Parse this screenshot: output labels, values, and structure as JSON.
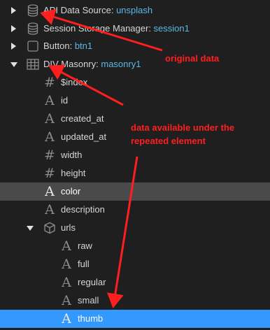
{
  "tree": [
    {
      "name": "API Data Source: ",
      "value": "unsplash",
      "icon": "database-icon",
      "expander": "right"
    },
    {
      "name": "Session Storage Manager: ",
      "value": "session1",
      "icon": "database-icon",
      "expander": "right"
    },
    {
      "name": "Button: ",
      "value": "btn1",
      "icon": "square-icon",
      "expander": "right"
    },
    {
      "name": "DIV Masonry: ",
      "value": "masonry1",
      "icon": "grid-icon",
      "expander": "down"
    },
    {
      "name": "$index",
      "icon": "number-icon"
    },
    {
      "name": "id",
      "icon": "text-icon"
    },
    {
      "name": "created_at",
      "icon": "text-icon"
    },
    {
      "name": "updated_at",
      "icon": "text-icon"
    },
    {
      "name": "width",
      "icon": "number-icon"
    },
    {
      "name": "height",
      "icon": "number-icon"
    },
    {
      "name": "color",
      "icon": "text-icon",
      "selected": "gray"
    },
    {
      "name": "description",
      "icon": "text-icon"
    },
    {
      "name": "urls",
      "icon": "cube-icon",
      "expander": "down"
    },
    {
      "name": "raw",
      "icon": "text-icon"
    },
    {
      "name": "full",
      "icon": "text-icon"
    },
    {
      "name": "regular",
      "icon": "text-icon"
    },
    {
      "name": "small",
      "icon": "text-icon"
    },
    {
      "name": "thumb",
      "icon": "text-icon",
      "selected": "blue"
    }
  ],
  "annotations": {
    "original": "original data",
    "repeated_line1": "data available under the",
    "repeated_line2": "repeated element"
  },
  "colors": {
    "background": "#1f1f1f",
    "value_text": "#5ab8e8",
    "selection_gray": "#4a4a4a",
    "selection_blue": "#3399ff",
    "annotation_red": "#ff1f1f"
  }
}
